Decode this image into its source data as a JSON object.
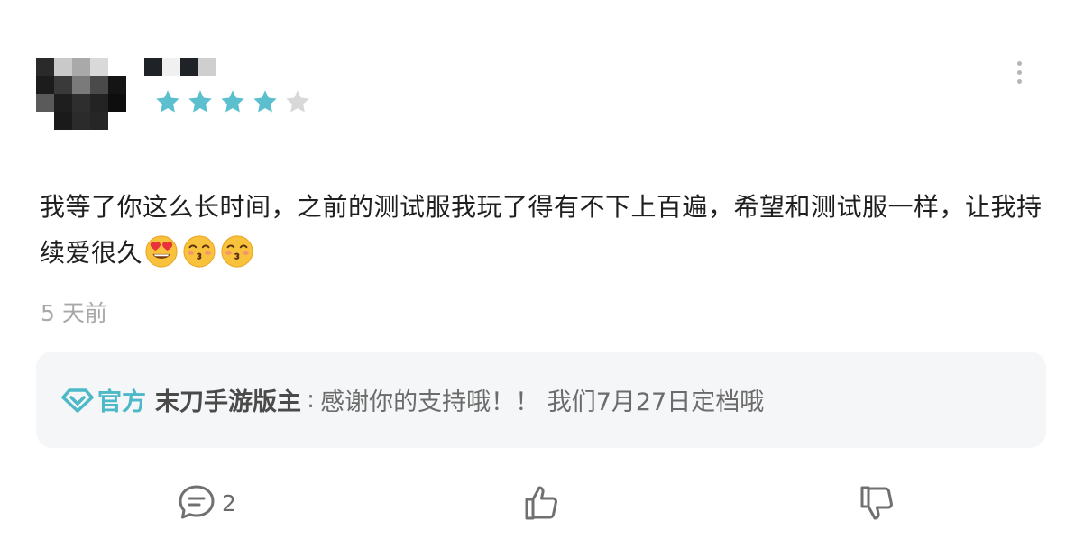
{
  "review": {
    "rating": 4,
    "max_rating": 5,
    "text": "我等了你这么长时间，之前的测试服我玩了得有不下上百遍，希望和测试服一样，让我持续爱很久",
    "emojis": [
      "smiling-face-with-heart-eyes",
      "kissing-face-with-smiling-eyes",
      "kissing-face-with-smiling-eyes"
    ],
    "timestamp": "5 天前"
  },
  "official_reply": {
    "badge_label": "官方",
    "author": "末刀手游版主",
    "separator": ":",
    "text": "感谢你的支持哦！！ 我们7月27日定档哦"
  },
  "actions": {
    "comment_count": "2"
  },
  "icons": {
    "star_filled_color": "#5bbfcd",
    "star_empty_color": "#d8d8d8",
    "official_color": "#4cb8c8",
    "action_icon_color": "#707070"
  }
}
